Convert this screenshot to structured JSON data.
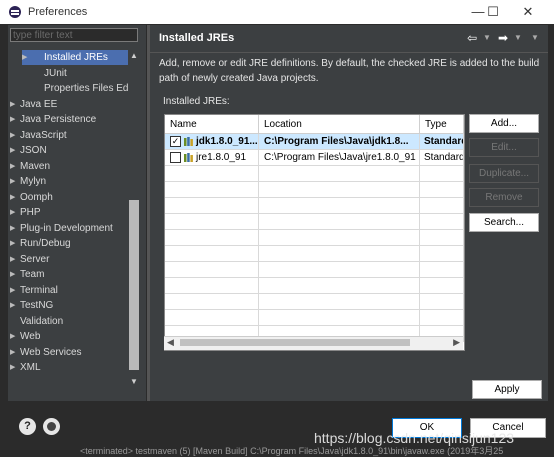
{
  "window": {
    "title": "Preferences",
    "controls": {
      "minimize": "—",
      "maximize": "☐",
      "close": "✕"
    }
  },
  "filter": {
    "placeholder": "type filter text"
  },
  "tree": {
    "items": [
      {
        "label": "Installed JREs",
        "indent": 2,
        "arrow": "▶",
        "selected": true
      },
      {
        "label": "JUnit",
        "indent": 2,
        "arrow": ""
      },
      {
        "label": "Properties Files Ed",
        "indent": 2,
        "arrow": ""
      },
      {
        "label": "Java EE",
        "indent": 1,
        "arrow": "▶"
      },
      {
        "label": "Java Persistence",
        "indent": 1,
        "arrow": "▶"
      },
      {
        "label": "JavaScript",
        "indent": 1,
        "arrow": "▶"
      },
      {
        "label": "JSON",
        "indent": 1,
        "arrow": "▶"
      },
      {
        "label": "Maven",
        "indent": 1,
        "arrow": "▶"
      },
      {
        "label": "Mylyn",
        "indent": 1,
        "arrow": "▶"
      },
      {
        "label": "Oomph",
        "indent": 1,
        "arrow": "▶"
      },
      {
        "label": "PHP",
        "indent": 1,
        "arrow": "▶"
      },
      {
        "label": "Plug-in Development",
        "indent": 1,
        "arrow": "▶"
      },
      {
        "label": "Run/Debug",
        "indent": 1,
        "arrow": "▶"
      },
      {
        "label": "Server",
        "indent": 1,
        "arrow": "▶"
      },
      {
        "label": "Team",
        "indent": 1,
        "arrow": "▶"
      },
      {
        "label": "Terminal",
        "indent": 1,
        "arrow": "▶"
      },
      {
        "label": "TestNG",
        "indent": 1,
        "arrow": "▶"
      },
      {
        "label": "Validation",
        "indent": 1,
        "arrow": ""
      },
      {
        "label": "Web",
        "indent": 1,
        "arrow": "▶"
      },
      {
        "label": "Web Services",
        "indent": 1,
        "arrow": "▶"
      },
      {
        "label": "XML",
        "indent": 1,
        "arrow": "▶"
      }
    ]
  },
  "page": {
    "title": "Installed JREs",
    "nav": {
      "back": "⇦",
      "forward": "➡",
      "menu": "▼"
    },
    "description": "Add, remove or edit JRE definitions. By default, the checked JRE is added to the build path of newly created Java projects.",
    "list_label": "Installed JREs:",
    "columns": [
      "Name",
      "Location",
      "Type"
    ],
    "rows": [
      {
        "checked": true,
        "name": "jdk1.8.0_91...",
        "location": "C:\\Program Files\\Java\\jdk1.8...",
        "type": "Standard",
        "selected": true
      },
      {
        "checked": false,
        "name": "jre1.8.0_91",
        "location": "C:\\Program Files\\Java\\jre1.8.0_91",
        "type": "Standard",
        "selected": false
      }
    ],
    "buttons": {
      "add": "Add...",
      "edit": "Edit...",
      "duplicate": "Duplicate...",
      "remove": "Remove",
      "search": "Search..."
    },
    "apply": "Apply"
  },
  "footer": {
    "help_icon": "?",
    "ok": "OK",
    "cancel": "Cancel",
    "status": "<terminated> testmaven (5) [Maven Build] C:\\Program Files\\Java\\jdk1.8.0_91\\bin\\javaw.exe (2019年3月25",
    "watermark": "https://blog.csdn.net/qinsijun123"
  }
}
